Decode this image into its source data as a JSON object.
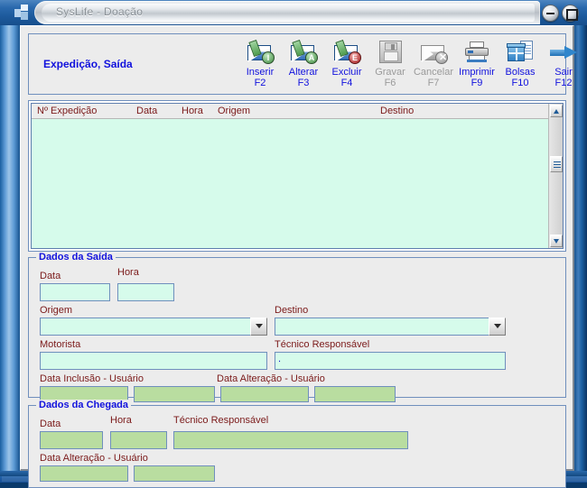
{
  "window": {
    "title": "SysLife - Doação",
    "logo_icon": "app-logo-icon",
    "minimize_icon": "minimize-icon",
    "maximize_icon": "maximize-icon"
  },
  "header": {
    "title": "Expedição, Saída",
    "title_color": "#1111dd",
    "toolbar": [
      {
        "label": "Inserir",
        "key": "F2",
        "icon": "envelope-insert-icon",
        "enabled": true,
        "badge": "I"
      },
      {
        "label": "Alterar",
        "key": "F3",
        "icon": "envelope-edit-icon",
        "enabled": true,
        "badge": "A"
      },
      {
        "label": "Excluir",
        "key": "F4",
        "icon": "envelope-delete-icon",
        "enabled": true,
        "badge": "E"
      },
      {
        "label": "Gravar",
        "key": "F6",
        "icon": "floppy-save-icon",
        "enabled": false,
        "badge": ""
      },
      {
        "label": "Cancelar",
        "key": "F7",
        "icon": "envelope-cancel-icon",
        "enabled": false,
        "badge": "x"
      },
      {
        "label": "Imprimir",
        "key": "F9",
        "icon": "printer-icon",
        "enabled": true,
        "badge": ""
      },
      {
        "label": "Bolsas",
        "key": "F10",
        "icon": "blue-box-document-icon",
        "enabled": true,
        "badge": ""
      },
      {
        "label": "Sair",
        "key": "F12",
        "icon": "blue-arrow-right-icon",
        "enabled": true,
        "badge": ""
      }
    ]
  },
  "grid": {
    "columns": [
      "Nº Expedição",
      "Data",
      "Hora",
      "Origem",
      "Destino"
    ],
    "rows": [],
    "header_color": "#7b1a1a",
    "row_background": "#d6fbeb",
    "scrollbar": {
      "up_icon": "scroll-up-arrow-icon",
      "down_icon": "scroll-down-arrow-icon",
      "thumb_icon": "scroll-thumb-icon"
    }
  },
  "saida": {
    "legend": "Dados da Saída",
    "data_label": "Data",
    "data_value": "",
    "hora_label": "Hora",
    "hora_value": "",
    "origem_label": "Origem",
    "origem_value": "",
    "destino_label": "Destino",
    "destino_value": "",
    "motorista_label": "Motorista",
    "motorista_value": "",
    "tecnico_label": "Técnico Responsável",
    "tecnico_value": "",
    "tecnico_caret": ".",
    "data_inclusao_label": "Data Inclusão - Usuário",
    "data_inclusao_value": "",
    "usuario_inclusao_value": "",
    "data_alteracao_label": "Data Alteração - Usuário",
    "data_alteracao_value": "",
    "usuario_alteracao_value": ""
  },
  "chegada": {
    "legend": "Dados da Chegada",
    "data_label": "Data",
    "data_value": "",
    "hora_label": "Hora",
    "hora_value": "",
    "tecnico_label": "Técnico Responsável",
    "tecnico_value": "",
    "data_alteracao_label": "Data Alteração - Usuário",
    "data_alteracao_value": "",
    "usuario_alteracao_value": ""
  },
  "colors": {
    "field_background": "#d6fbeb",
    "readonly_background": "#b9dda0",
    "label": "#7b1a1a",
    "legend": "#1111dd",
    "panel_border": "#6f8fbd",
    "client_background": "#ececec"
  }
}
